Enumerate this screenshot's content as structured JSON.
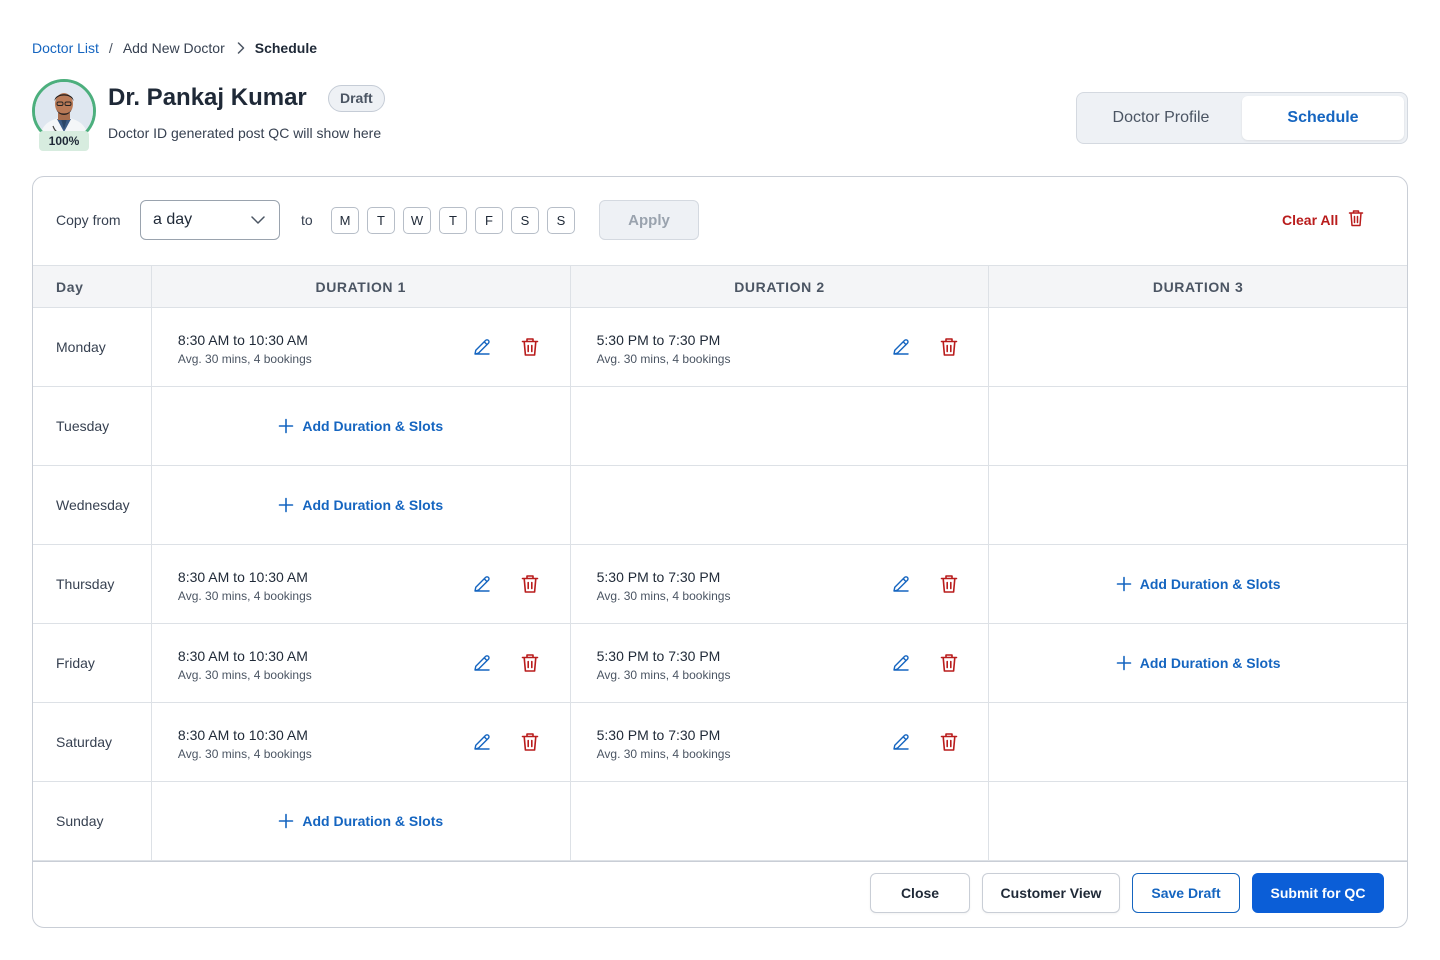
{
  "colors": {
    "primary": "#1565c0",
    "danger": "#b91c1c",
    "success": "#4caf7d"
  },
  "breadcrumb": {
    "root": "Doctor List",
    "separator": "/",
    "middle": "Add New Doctor",
    "current": "Schedule"
  },
  "doctor": {
    "name": "Dr. Pankaj Kumar",
    "status": "Draft",
    "subtitle": "Doctor ID generated post QC will show here",
    "profile_completion": "100%"
  },
  "tabs": [
    {
      "label": "Doctor Profile",
      "active": false
    },
    {
      "label": "Schedule",
      "active": true
    }
  ],
  "toolbar": {
    "copy_from_label": "Copy from",
    "copy_from_value": "a day",
    "to_label": "to",
    "days": [
      "M",
      "T",
      "W",
      "T",
      "F",
      "S",
      "S"
    ],
    "apply_label": "Apply",
    "clear_all_label": "Clear All"
  },
  "table": {
    "headers": [
      "Day",
      "DURATION 1",
      "DURATION 2",
      "DURATION 3"
    ],
    "add_label": "Add Duration & Slots",
    "rows": [
      {
        "day": "Monday",
        "d1": {
          "time": "8:30 AM to 10:30 AM",
          "meta": "Avg. 30 mins, 4 bookings"
        },
        "d2": {
          "time": "5:30 PM to 7:30 PM",
          "meta": "Avg. 30 mins, 4 bookings"
        }
      },
      {
        "day": "Tuesday"
      },
      {
        "day": "Wednesday"
      },
      {
        "day": "Thursday",
        "d1": {
          "time": "8:30 AM to 10:30 AM",
          "meta": "Avg. 30 mins, 4 bookings"
        },
        "d2": {
          "time": "5:30 PM to 7:30 PM",
          "meta": "Avg. 30 mins, 4 bookings"
        }
      },
      {
        "day": "Friday",
        "d1": {
          "time": "8:30 AM to 10:30 AM",
          "meta": "Avg. 30 mins, 4 bookings"
        },
        "d2": {
          "time": "5:30 PM to 7:30 PM",
          "meta": "Avg. 30 mins, 4 bookings"
        }
      },
      {
        "day": "Saturday",
        "d1": {
          "time": "8:30 AM to 10:30 AM",
          "meta": "Avg. 30 mins, 4 bookings"
        },
        "d2": {
          "time": "5:30 PM to 7:30 PM",
          "meta": "Avg. 30 mins, 4 bookings"
        }
      },
      {
        "day": "Sunday"
      }
    ]
  },
  "footer": {
    "close_label": "Close",
    "customer_view_label": "Customer View",
    "save_draft_label": "Save Draft",
    "submit_label": "Submit for QC"
  }
}
